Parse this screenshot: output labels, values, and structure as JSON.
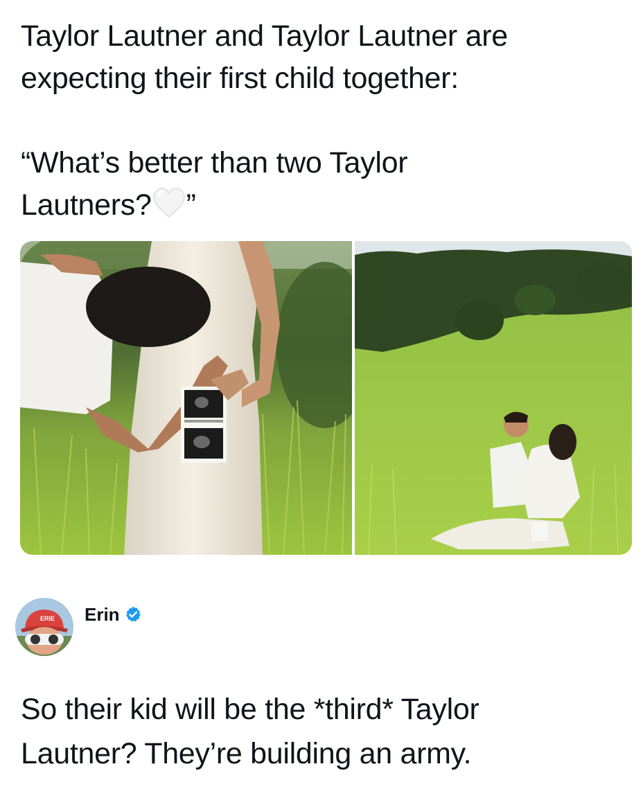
{
  "post": {
    "line_1": "Taylor Lautner and Taylor Lautner are\nexpecting their first child together:",
    "line_2": "“What’s better than two Taylor\nLautners?",
    "line_2_end": "”",
    "heart_icon": "white-heart-emoji",
    "images": [
      {
        "icon": "photo-couple-ultrasound"
      },
      {
        "icon": "photo-couple-in-field"
      }
    ]
  },
  "reply": {
    "author": "Erin",
    "verified_color": "#1d9bf0",
    "avatar_icon": "avatar-red-cap-sunglasses",
    "text": "So their kid will be the *third* Taylor\nLautner? They’re building an army."
  }
}
